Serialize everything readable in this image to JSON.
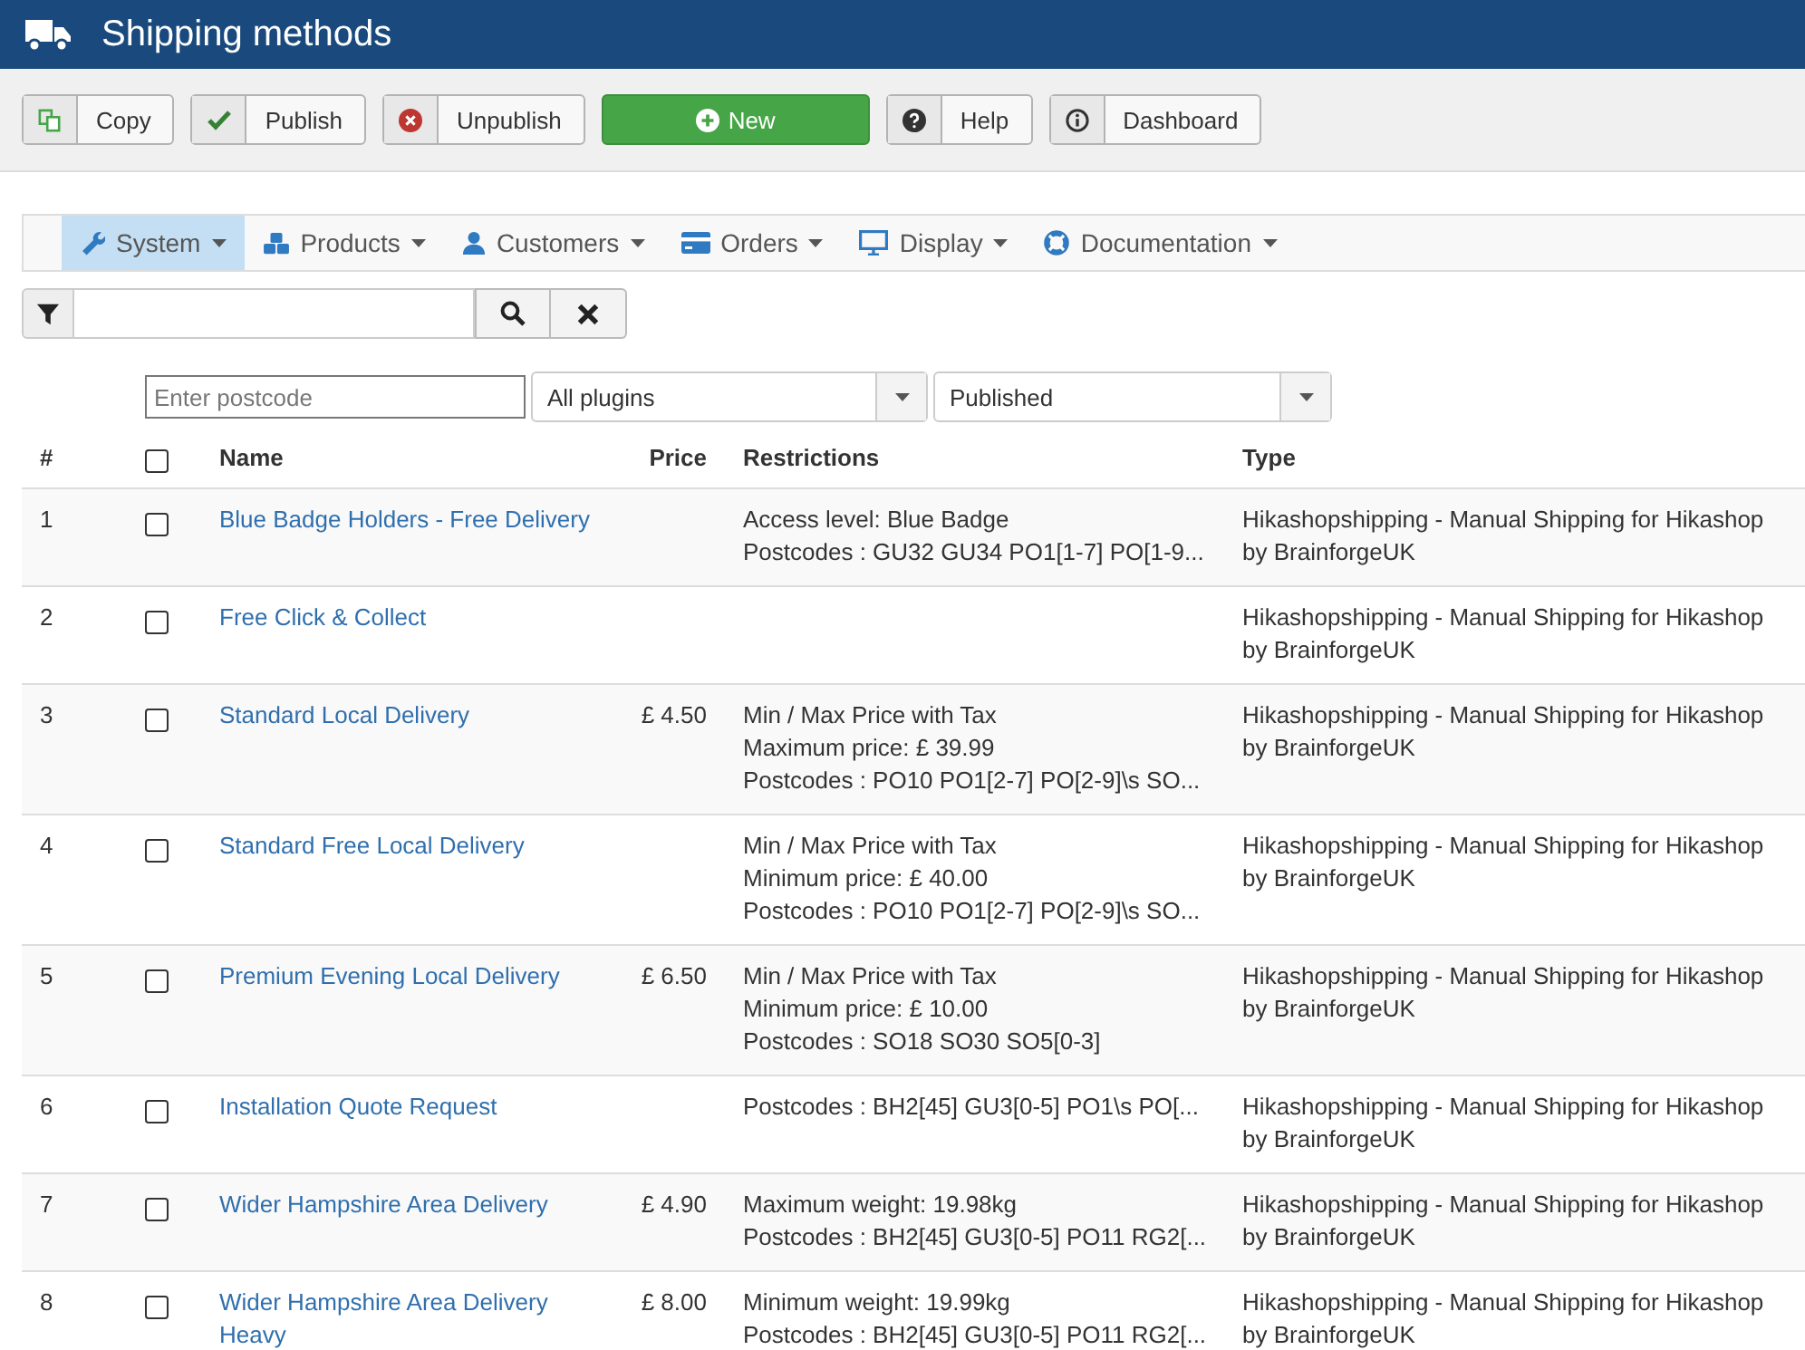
{
  "header": {
    "title": "Shipping methods"
  },
  "toolbar": [
    {
      "kind": "copy",
      "label": "Copy"
    },
    {
      "kind": "publish",
      "label": "Publish"
    },
    {
      "kind": "unpublish",
      "label": "Unpublish"
    },
    {
      "kind": "new",
      "label": "New"
    },
    {
      "kind": "help",
      "label": "Help"
    },
    {
      "kind": "dashboard",
      "label": "Dashboard"
    }
  ],
  "menu": [
    {
      "label": "System",
      "selected": true
    },
    {
      "label": "Products",
      "selected": false
    },
    {
      "label": "Customers",
      "selected": false
    },
    {
      "label": "Orders",
      "selected": false
    },
    {
      "label": "Display",
      "selected": false
    },
    {
      "label": "Documentation",
      "selected": false
    }
  ],
  "filters": {
    "postcode_placeholder": "Enter postcode",
    "plugin": "All plugins",
    "status": "Published"
  },
  "table": {
    "select_all_checked": false,
    "columns": [
      "#",
      "Name",
      "Price",
      "Restrictions",
      "Type"
    ],
    "rows": [
      {
        "num": "1",
        "checked": false,
        "name": [
          "Blue Badge Holders - Free Delivery"
        ],
        "price": "",
        "restrictions": [
          "Access level: Blue Badge",
          "Postcodes : GU32 GU34 PO1[1-7] PO[1-9..."
        ],
        "type": "Hikashopshipping - Manual Shipping for Hikashop by BrainforgeUK"
      },
      {
        "num": "2",
        "checked": false,
        "name": [
          "Free Click & Collect"
        ],
        "price": "",
        "restrictions": [],
        "type": "Hikashopshipping - Manual Shipping for Hikashop by BrainforgeUK"
      },
      {
        "num": "3",
        "checked": false,
        "name": [
          "Standard Local Delivery"
        ],
        "price": "£ 4.50",
        "restrictions": [
          "Min / Max Price with Tax",
          "Maximum price: £ 39.99",
          "Postcodes : PO10 PO1[2-7] PO[2-9]\\s SO..."
        ],
        "type": "Hikashopshipping - Manual Shipping for Hikashop by BrainforgeUK"
      },
      {
        "num": "4",
        "checked": false,
        "name": [
          "Standard Free Local Delivery"
        ],
        "price": "",
        "restrictions": [
          "Min / Max Price with Tax",
          "Minimum price: £ 40.00",
          "Postcodes : PO10 PO1[2-7] PO[2-9]\\s SO..."
        ],
        "type": "Hikashopshipping - Manual Shipping for Hikashop by BrainforgeUK"
      },
      {
        "num": "5",
        "checked": false,
        "name": [
          "Premium Evening Local Delivery"
        ],
        "price": "£ 6.50",
        "restrictions": [
          "Min / Max Price with Tax",
          "Minimum price: £ 10.00",
          "Postcodes : SO18 SO30 SO5[0-3]"
        ],
        "type": "Hikashopshipping - Manual Shipping for Hikashop by BrainforgeUK"
      },
      {
        "num": "6",
        "checked": false,
        "name": [
          "Installation Quote Request"
        ],
        "price": "",
        "restrictions": [
          "Postcodes : BH2[45] GU3[0-5] PO1\\s PO[..."
        ],
        "type": "Hikashopshipping - Manual Shipping for Hikashop by BrainforgeUK"
      },
      {
        "num": "7",
        "checked": false,
        "name": [
          "Wider Hampshire Area Delivery"
        ],
        "price": "£ 4.90",
        "restrictions": [
          "Maximum weight: 19.98kg",
          "Postcodes : BH2[45] GU3[0-5] PO11 RG2[..."
        ],
        "type": "Hikashopshipping - Manual Shipping for Hikashop by BrainforgeUK"
      },
      {
        "num": "8",
        "checked": false,
        "name": [
          "Wider Hampshire Area Delivery",
          "Heavy"
        ],
        "price": "£ 8.00",
        "restrictions": [
          "Minimum weight: 19.99kg",
          "Postcodes : BH2[45] GU3[0-5] PO11 RG2[..."
        ],
        "type": "Hikashopshipping - Manual Shipping for Hikashop by BrainforgeUK"
      }
    ]
  }
}
